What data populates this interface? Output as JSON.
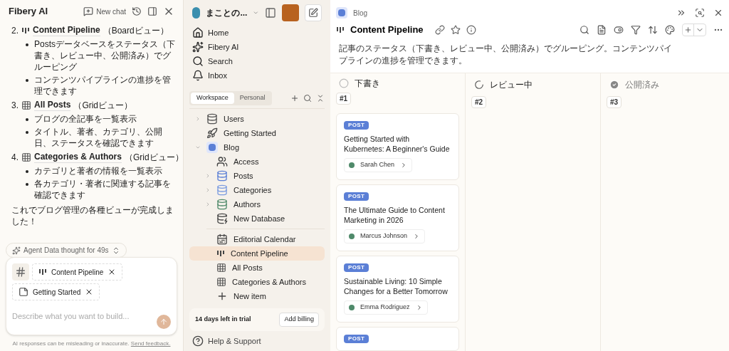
{
  "chat": {
    "title": "Fibery AI",
    "new_chat": "New chat",
    "views": [
      {
        "number": "2.",
        "kind": "board",
        "name": "Content Pipeline",
        "suffix": "（Boardビュー）",
        "bullets": [
          "Postsデータベースをステータス（下書き、レビュー中、公開済み）でグルーピング",
          "コンテンツパイプラインの進捗を管理できます"
        ]
      },
      {
        "number": "3.",
        "kind": "grid",
        "name": "All Posts",
        "suffix": "（Gridビュー）",
        "bullets": [
          "ブログの全記事を一覧表示",
          "タイトル、著者、カテゴリ、公開日、ステータスを確認できます"
        ]
      },
      {
        "number": "4.",
        "kind": "grid",
        "name": "Categories & Authors",
        "suffix": "（Gridビュー）",
        "bullets": [
          "カテゴリと著者の情報を一覧表示",
          "各カテゴリ・著者に関連する記事を確認できます"
        ]
      }
    ],
    "closing": "これでブログ管理の各種ビューが完成しました！",
    "thought": "Agent Data thought for 49s",
    "chips": [
      {
        "kind": "board",
        "label": "Content Pipeline"
      },
      {
        "kind": "doc",
        "label": "Getting Started"
      }
    ],
    "placeholder": "Describe what you want to build...",
    "disclaimer": "AI responses can be misleading or inaccurate.",
    "feedback": "Send feedback."
  },
  "sidebar": {
    "workspace": "まことの...",
    "nav": [
      {
        "kind": "home",
        "label": "Home"
      },
      {
        "kind": "ai",
        "label": "Fibery AI"
      },
      {
        "kind": "search",
        "label": "Search"
      },
      {
        "kind": "inbox",
        "label": "Inbox"
      }
    ],
    "tabs": [
      {
        "label": "Workspace",
        "selected": true
      },
      {
        "label": "Personal",
        "selected": false
      }
    ],
    "tree": [
      {
        "kind": "db",
        "color": "#555555",
        "label": "Users",
        "expanded": false
      },
      {
        "kind": "rocket",
        "label": "Getting Started"
      },
      {
        "kind": "space",
        "label": "Blog",
        "expanded": true,
        "children": [
          {
            "kind": "access",
            "label": "Access"
          },
          {
            "kind": "db",
            "color": "#5b7fd6",
            "label": "Posts",
            "expanded": false
          },
          {
            "kind": "db",
            "color": "#7a9be0",
            "label": "Categories",
            "expanded": false
          },
          {
            "kind": "db",
            "color": "#4f8a6a",
            "label": "Authors",
            "expanded": false
          },
          {
            "kind": "newdb",
            "label": "New Database"
          }
        ],
        "views": [
          {
            "kind": "calendar",
            "label": "Editorial Calendar",
            "selected": false
          },
          {
            "kind": "board",
            "label": "Content Pipeline",
            "selected": true
          },
          {
            "kind": "grid",
            "label": "All Posts",
            "selected": false
          },
          {
            "kind": "grid",
            "label": "Categories & Authors",
            "selected": false
          },
          {
            "kind": "add",
            "label": "New item",
            "selected": false
          }
        ]
      }
    ],
    "trial": "14 days left in trial",
    "billing": "Add billing",
    "help": "Help & Support"
  },
  "main": {
    "breadcrumb": "Blog",
    "title": "Content Pipeline",
    "description": "記事のステータス（下書き、レビュー中、公開済み）でグルーピング。コンテンツパイプラインの進捗を管理できます。",
    "columns": [
      {
        "kind": "todo",
        "name": "下書き",
        "count": "#1",
        "cards": [
          {
            "tag": "POST",
            "title": "Getting Started with Kubernetes: A Beginner's Guide",
            "author": "Sarah Chen"
          },
          {
            "tag": "POST",
            "title": "The Ultimate Guide to Content Marketing in 2026",
            "author": "Marcus Johnson"
          },
          {
            "tag": "POST",
            "title": "Sustainable Living: 10 Simple Changes for a Better Tomorrow",
            "author": "Emma Rodriguez"
          },
          {
            "tag": "POST"
          }
        ]
      },
      {
        "kind": "progress",
        "name": "レビュー中",
        "count": "#2"
      },
      {
        "kind": "done",
        "name": "公開済み",
        "count": "#3"
      }
    ]
  }
}
